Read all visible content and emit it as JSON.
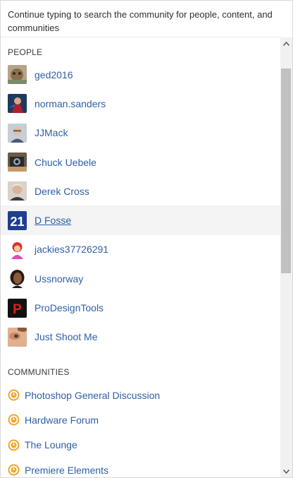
{
  "hint": "Continue typing to search the community for people, content, and communities",
  "people_section": {
    "title": "PEOPLE",
    "items": [
      {
        "name": "ged2016"
      },
      {
        "name": "norman.sanders"
      },
      {
        "name": "JJMack"
      },
      {
        "name": "Chuck Uebele"
      },
      {
        "name": "Derek Cross"
      },
      {
        "name": "D Fosse"
      },
      {
        "name": "jackies37726291"
      },
      {
        "name": "Ussnorway"
      },
      {
        "name": "ProDesignTools"
      },
      {
        "name": "Just Shoot Me"
      }
    ]
  },
  "communities_section": {
    "title": "COMMUNITIES",
    "items": [
      {
        "name": "Photoshop General Discussion"
      },
      {
        "name": "Hardware Forum"
      },
      {
        "name": "The Lounge"
      },
      {
        "name": "Premiere Elements"
      }
    ]
  },
  "colors": {
    "link": "#2e5fa7",
    "community_icon": "#f2a526",
    "hover_row": "#f4f4f4"
  },
  "avatar_labels": {
    "d_fosse": "21",
    "prodesigntools": "P"
  },
  "scrollbar": {
    "up_icon": "chevron-up-icon",
    "down_icon": "chevron-down-icon"
  }
}
